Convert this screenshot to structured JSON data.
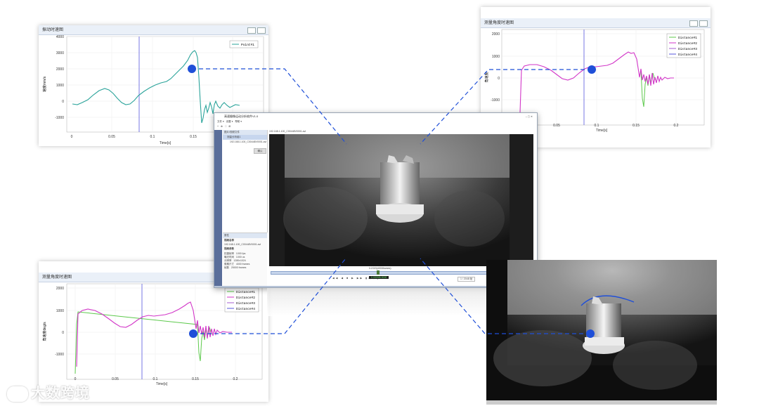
{
  "plots": {
    "tl": {
      "title": "振动时速图",
      "ylabel": "速度mm/s",
      "xlabel": "Time[s]",
      "yticks": [
        "4000",
        "3000",
        "2000",
        "1000",
        "0",
        "-1000"
      ],
      "xticks": [
        "0",
        "0.05",
        "0.1",
        "0.15"
      ],
      "legend": [
        "Point#1"
      ]
    },
    "tr": {
      "title": "测量角度时速图",
      "ylabel": "角速度",
      "xlabel": "Time[s]",
      "yticks": [
        "2000",
        "1000",
        "0",
        "-1000"
      ],
      "xticks": [
        "0.05",
        "0.1",
        "0.15",
        "0.2"
      ],
      "legend": [
        "Distance#1",
        "Distance#2",
        "Distance#3",
        "Distance#4"
      ]
    },
    "bl": {
      "title": "测量角度时速图",
      "ylabel": "角速度deg/s",
      "xlabel": "Time[s]",
      "yticks": [
        "2000",
        "1000",
        "0",
        "-1000"
      ],
      "xticks": [
        "0",
        "0.05",
        "0.1",
        "0.15",
        "0.2"
      ],
      "legend": [
        "Distance#1",
        "Distance#2",
        "Distance#3",
        "Distance#4"
      ]
    }
  },
  "software": {
    "title": "高速摄像运动分析软件V1.0",
    "menu": [
      "文件",
      "设置",
      "帮助"
    ],
    "tree_header": "图片/视频文件",
    "tree_item1": "测量分析组1",
    "tree_item2": "192.168.1.100_C00448V0001.avi",
    "open_button": "确认",
    "video_caption": "192.168.1.100_C00448V0001.avi",
    "frame_label": "0:2/3/3(4000frames)",
    "props_header": "属性",
    "props_name_label": "视频名称",
    "props_file": "192.168.1.100_C00448V0001.avi",
    "props_section": "视频参数",
    "props": [
      {
        "k": "拍摄帧率",
        "v": "1000 fps"
      },
      {
        "k": "曝光时间",
        "v": "1000 us"
      },
      {
        "k": "分辨率",
        "v": "1280x1024"
      },
      {
        "k": "像素尺寸",
        "v": "4000 frames"
      },
      {
        "k": "帧数",
        "v": "25000 frames"
      }
    ],
    "counter": "0.0000/6.0000",
    "page": "1 / 2048 帧"
  },
  "watermark": "大数跨境",
  "colors": {
    "accent": "#1f4fd8",
    "teal": "#2aa39a",
    "magenta": "#d236c8",
    "green": "#5cc94b",
    "blue": "#5555dd"
  }
}
